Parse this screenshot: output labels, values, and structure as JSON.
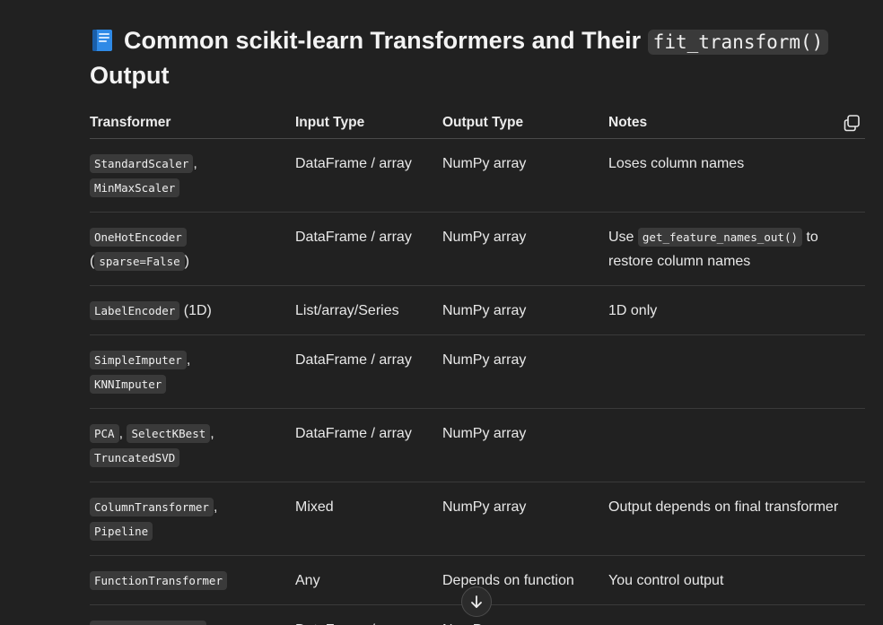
{
  "heading": {
    "icon": "blue-book-icon",
    "text_before": "Common scikit-learn Transformers and Their",
    "code": "fit_transform()",
    "text_after": "Output"
  },
  "table": {
    "headers": [
      "Transformer",
      "Input Type",
      "Output Type",
      "Notes"
    ],
    "rows": [
      {
        "transformer": [
          {
            "code": "StandardScaler"
          },
          {
            "text": ","
          },
          {
            "break": true
          },
          {
            "code": "MinMaxScaler"
          }
        ],
        "input": "DataFrame / array",
        "output": "NumPy array",
        "notes": [
          {
            "text": "Loses column names"
          }
        ]
      },
      {
        "transformer": [
          {
            "code": "OneHotEncoder"
          },
          {
            "break": true
          },
          {
            "text": "("
          },
          {
            "code": "sparse=False"
          },
          {
            "text": ")"
          }
        ],
        "input": "DataFrame / array",
        "output": "NumPy array",
        "notes": [
          {
            "text": "Use "
          },
          {
            "code": "get_feature_names_out()"
          },
          {
            "text": " to restore column names"
          }
        ]
      },
      {
        "transformer": [
          {
            "code": "LabelEncoder"
          },
          {
            "text": " (1D)"
          }
        ],
        "input": "List/array/Series",
        "output": "NumPy array",
        "notes": [
          {
            "text": "1D only"
          }
        ]
      },
      {
        "transformer": [
          {
            "code": "SimpleImputer"
          },
          {
            "text": ","
          },
          {
            "break": true
          },
          {
            "code": "KNNImputer"
          }
        ],
        "input": "DataFrame / array",
        "output": "NumPy array",
        "notes": []
      },
      {
        "transformer": [
          {
            "code": "PCA"
          },
          {
            "text": ", "
          },
          {
            "code": "SelectKBest"
          },
          {
            "text": ","
          },
          {
            "break": true
          },
          {
            "code": "TruncatedSVD"
          }
        ],
        "input": "DataFrame / array",
        "output": "NumPy array",
        "notes": []
      },
      {
        "transformer": [
          {
            "code": "ColumnTransformer"
          },
          {
            "text": ","
          },
          {
            "break": true
          },
          {
            "code": "Pipeline"
          }
        ],
        "input": "Mixed",
        "output": "NumPy array",
        "notes": [
          {
            "text": "Output depends on final transformer"
          }
        ]
      },
      {
        "transformer": [
          {
            "code": "FunctionTransformer"
          }
        ],
        "input": "Any",
        "output": "Depends on function",
        "notes": [
          {
            "text": "You control output"
          }
        ]
      },
      {
        "transformer": [
          {
            "code": "KBinsDiscretizer"
          }
        ],
        "input": "DataFrame / array",
        "output": "NumPy array",
        "notes": []
      }
    ]
  },
  "controls": {
    "copy_icon": "copy-icon",
    "scroll_down_icon": "arrow-down-icon"
  }
}
